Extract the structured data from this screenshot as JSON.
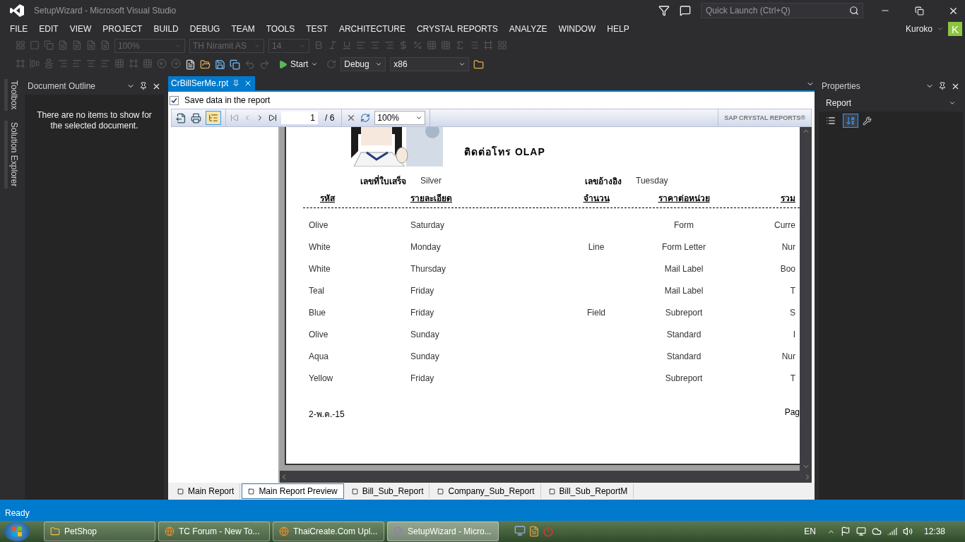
{
  "window": {
    "title": "SetupWizard - Microsoft Visual Studio",
    "quick_launch": {
      "placeholder": "Quick Launch (Ctrl+Q)"
    }
  },
  "menu": [
    "FILE",
    "EDIT",
    "VIEW",
    "PROJECT",
    "BUILD",
    "DEBUG",
    "TEAM",
    "TOOLS",
    "TEST",
    "ARCHITECTURE",
    "CRYSTAL REPORTS",
    "ANALYZE",
    "WINDOW",
    "HELP"
  ],
  "user": {
    "name": "Kuroko",
    "initial": "K"
  },
  "toolbar": {
    "zoom": {
      "value": "100%",
      "disabled": true
    },
    "font": {
      "value": "TH Niramit AS",
      "disabled": true
    },
    "size": {
      "value": "14",
      "disabled": true
    },
    "start": "Start",
    "configuration": "Debug",
    "platform": "x86"
  },
  "side_tabs": [
    "Toolbox",
    "Solution Explorer"
  ],
  "document_outline": {
    "title": "Document Outline",
    "message": "There are no items to show for the selected document."
  },
  "editor_tabs": [
    {
      "label": "CrBillSerMe.rpt",
      "selected": true
    }
  ],
  "save_data": {
    "label": "Save data in the report",
    "checked": true
  },
  "viewer": {
    "page": "1",
    "page_total": "/ 6",
    "zoom": "100%",
    "brand": "SAP CRYSTAL REPORTS®",
    "group_tree": true
  },
  "report": {
    "title": "ติดต่อโทร OLAP",
    "fields": [
      {
        "label": "เลขที่ใบเสร็จ",
        "value": "Silver"
      },
      {
        "label": "เลขอ้างอิง",
        "value": "Tuesday"
      }
    ],
    "columns": [
      "รหัส",
      "รายละเอียด",
      "จำนวน",
      "ราคาต่อหน่วย",
      "รวม"
    ],
    "rows": [
      [
        "Olive",
        "Saturday",
        "",
        "Form",
        "Curre"
      ],
      [
        "White",
        "Monday",
        "Line",
        "Form Letter",
        "Nur"
      ],
      [
        "White",
        "Thursday",
        "",
        "Mail Label",
        "Boo"
      ],
      [
        "Teal",
        "Friday",
        "",
        "Mail Label",
        "T"
      ],
      [
        "Blue",
        "Friday",
        "Field",
        "Subreport",
        "S"
      ],
      [
        "Olive",
        "Sunday",
        "",
        "Standard",
        "I"
      ],
      [
        "Aqua",
        "Sunday",
        "",
        "Standard",
        "Nur"
      ],
      [
        "Yellow",
        "Friday",
        "",
        "Subreport",
        "T"
      ]
    ],
    "footer_date": "2-พ.ค.-15",
    "footer_page": "Pag"
  },
  "properties": {
    "title": "Properties",
    "object": "Report",
    "alphabetical": true
  },
  "bottom_tabs": [
    {
      "label": "Main Report",
      "selected": false
    },
    {
      "label": "Main Report Preview",
      "selected": true
    },
    {
      "label": "Bill_Sub_Report",
      "selected": false
    },
    {
      "label": "Company_Sub_Report",
      "selected": false
    },
    {
      "label": "Bill_Sub_ReportM",
      "selected": false
    }
  ],
  "status_bar": "Ready",
  "taskbar": {
    "items": [
      {
        "label": "PetShop",
        "selected": false,
        "kind": "folder"
      },
      {
        "label": "TC Forum - New To...",
        "selected": false,
        "kind": "browser"
      },
      {
        "label": "ThaiCreate.Com Upl...",
        "selected": false,
        "kind": "browser"
      },
      {
        "label": "SetupWizard - Micro...",
        "selected": true,
        "kind": "studio"
      }
    ],
    "language": "EN",
    "time": "12:38"
  }
}
